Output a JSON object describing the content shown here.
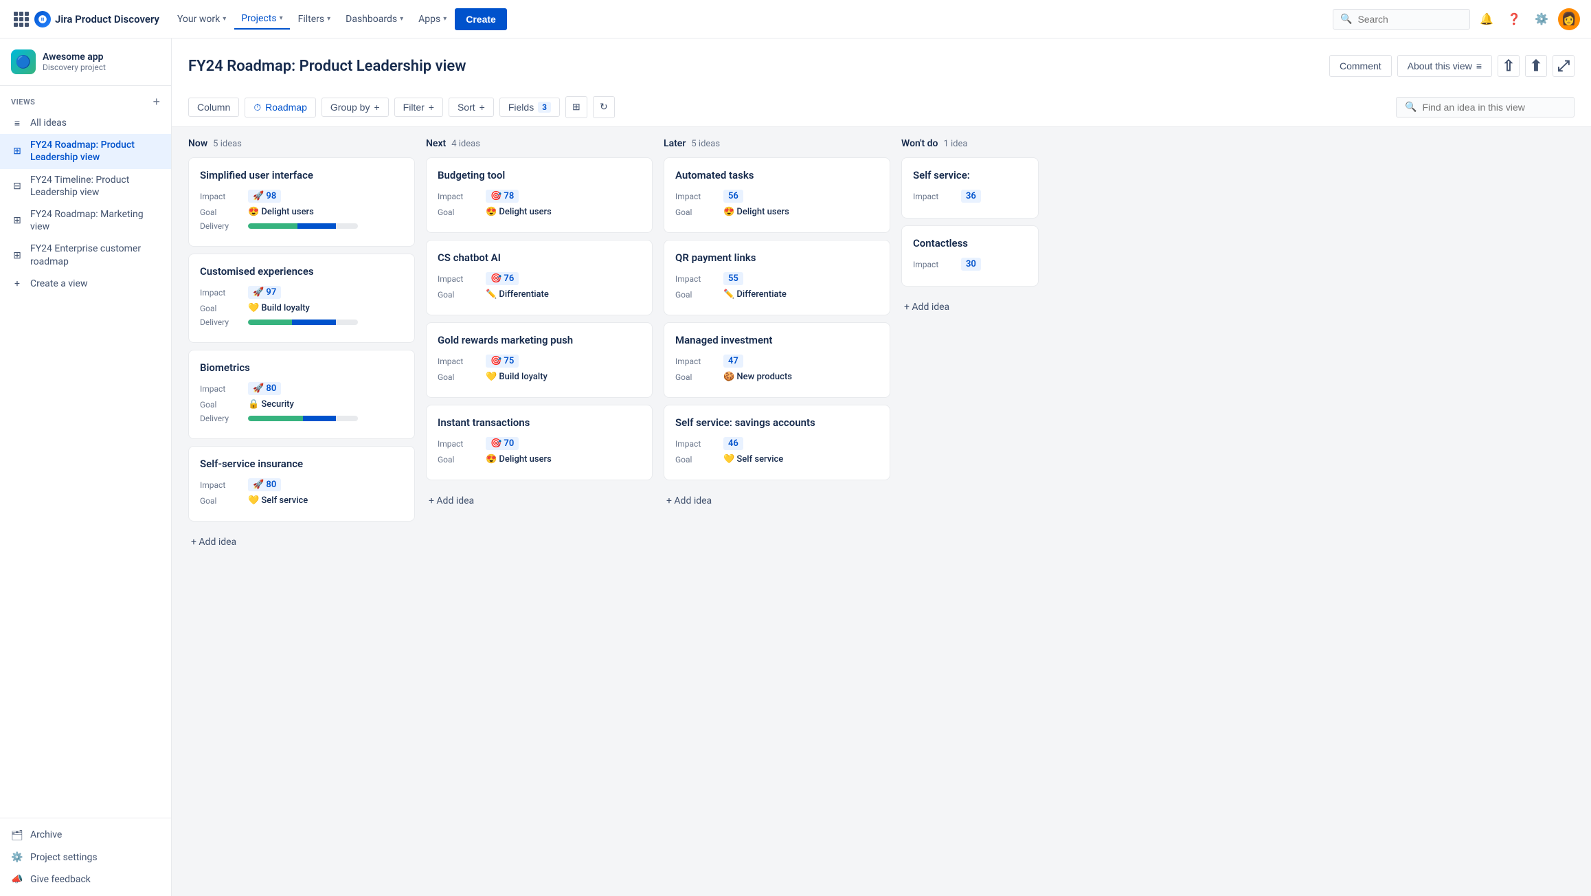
{
  "topnav": {
    "app_name": "Jira Product Discovery",
    "nav_items": [
      {
        "label": "Your work",
        "active": false
      },
      {
        "label": "Projects",
        "active": true
      },
      {
        "label": "Filters",
        "active": false
      },
      {
        "label": "Dashboards",
        "active": false
      },
      {
        "label": "Apps",
        "active": false
      }
    ],
    "create_label": "Create",
    "search_placeholder": "Search"
  },
  "sidebar": {
    "project_name": "Awesome app",
    "project_type": "Discovery project",
    "views_section": "VIEWS",
    "views": [
      {
        "label": "All ideas",
        "icon": "list",
        "active": false
      },
      {
        "label": "FY24 Roadmap: Product Leadership view",
        "icon": "grid",
        "active": true
      },
      {
        "label": "FY24 Timeline: Product Leadership view",
        "icon": "timeline",
        "active": false
      },
      {
        "label": "FY24 Roadmap: Marketing view",
        "icon": "grid",
        "active": false
      },
      {
        "label": "FY24 Enterprise customer roadmap",
        "icon": "grid",
        "active": false
      },
      {
        "label": "Create a view",
        "icon": "plus",
        "active": false
      }
    ],
    "archive_label": "Archive",
    "settings_label": "Project settings",
    "feedback_label": "Give feedback"
  },
  "page": {
    "title": "FY24 Roadmap: Product Leadership view",
    "comment_label": "Comment",
    "about_label": "About this view",
    "toolbar": {
      "column_label": "Column",
      "roadmap_label": "Roadmap",
      "groupby_label": "Group by",
      "filter_label": "Filter",
      "sort_label": "Sort",
      "fields_label": "Fields",
      "fields_count": "3",
      "find_placeholder": "Find an idea in this view"
    }
  },
  "board": {
    "columns": [
      {
        "label": "Now",
        "count": "5 ideas",
        "cards": [
          {
            "title": "Simplified user interface",
            "impact": "98",
            "impact_icon": "🚀",
            "goal": "Delight users",
            "goal_icon": "😍",
            "has_delivery": true,
            "delivery_green": 45,
            "delivery_blue": 35
          },
          {
            "title": "Customised experiences",
            "impact": "97",
            "impact_icon": "🚀",
            "goal": "Build loyalty",
            "goal_icon": "💛",
            "has_delivery": true,
            "delivery_green": 40,
            "delivery_blue": 40
          },
          {
            "title": "Biometrics",
            "impact": "80",
            "impact_icon": "🚀",
            "goal": "Security",
            "goal_icon": "🔒",
            "has_delivery": true,
            "delivery_green": 50,
            "delivery_blue": 30
          },
          {
            "title": "Self-service insurance",
            "impact": "80",
            "impact_icon": "🚀",
            "goal": "Self service",
            "goal_icon": "💛",
            "has_delivery": false
          }
        ]
      },
      {
        "label": "Next",
        "count": "4 ideas",
        "cards": [
          {
            "title": "Budgeting tool",
            "impact": "78",
            "impact_icon": "🎯",
            "goal": "Delight users",
            "goal_icon": "😍",
            "has_delivery": false
          },
          {
            "title": "CS chatbot AI",
            "impact": "76",
            "impact_icon": "🎯",
            "goal": "Differentiate",
            "goal_icon": "✏️",
            "has_delivery": false
          },
          {
            "title": "Gold rewards marketing push",
            "impact": "75",
            "impact_icon": "🎯",
            "goal": "Build loyalty",
            "goal_icon": "💛",
            "has_delivery": false
          },
          {
            "title": "Instant transactions",
            "impact": "70",
            "impact_icon": "🎯",
            "goal": "Delight users",
            "goal_icon": "😍",
            "has_delivery": false
          }
        ]
      },
      {
        "label": "Later",
        "count": "5 ideas",
        "cards": [
          {
            "title": "Automated tasks",
            "impact": "56",
            "impact_icon": "",
            "goal": "Delight users",
            "goal_icon": "😍",
            "has_delivery": false
          },
          {
            "title": "QR payment links",
            "impact": "55",
            "impact_icon": "",
            "goal": "Differentiate",
            "goal_icon": "✏️",
            "has_delivery": false
          },
          {
            "title": "Managed investment",
            "impact": "47",
            "impact_icon": "",
            "goal": "New products",
            "goal_icon": "🍪",
            "has_delivery": false
          },
          {
            "title": "Self service: savings accounts",
            "impact": "46",
            "impact_icon": "",
            "goal": "Self service",
            "goal_icon": "💛",
            "has_delivery": false
          }
        ]
      },
      {
        "label": "Won't do",
        "count": "1 idea",
        "cards": [
          {
            "title": "Self service:",
            "impact": "36",
            "impact_icon": "",
            "goal": "",
            "goal_icon": "✏️",
            "has_delivery": false,
            "partial": true
          },
          {
            "title": "Contactless",
            "impact": "30",
            "impact_icon": "",
            "goal": "",
            "goal_icon": "✏️",
            "has_delivery": false,
            "partial": true
          }
        ]
      }
    ]
  }
}
